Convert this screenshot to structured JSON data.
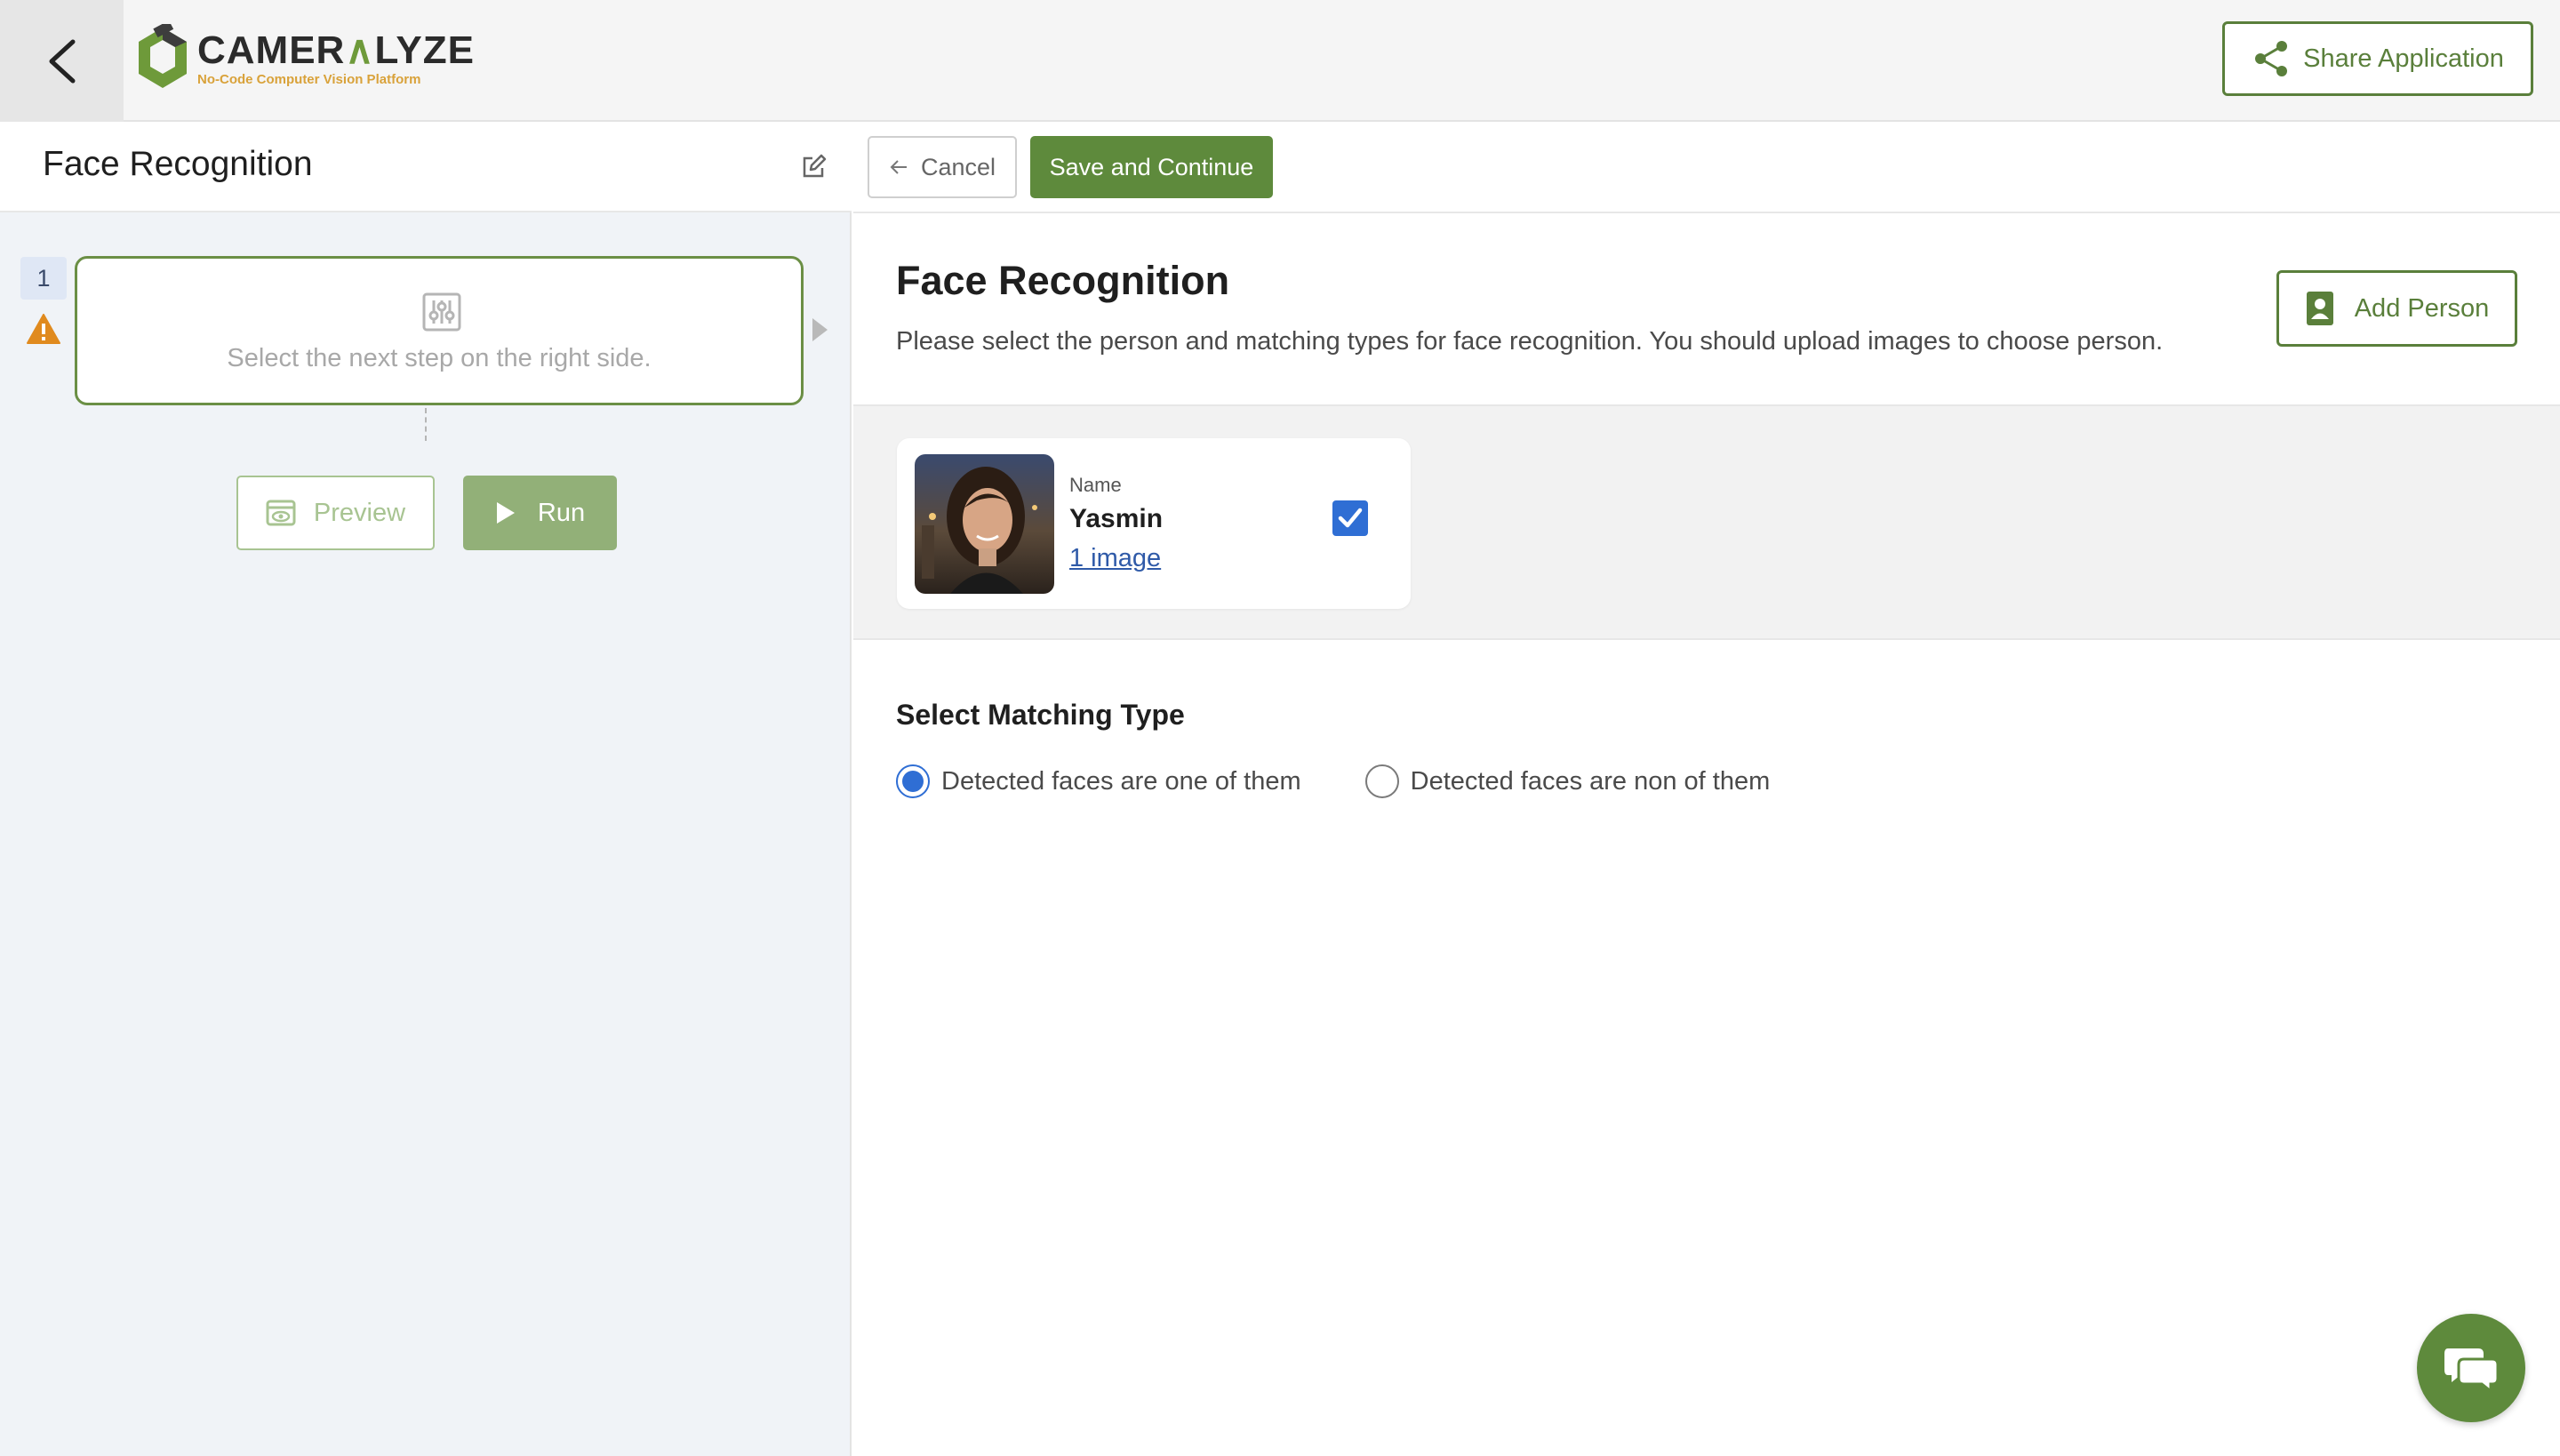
{
  "header": {
    "logo_word_left": "CAMER",
    "logo_word_right": "LYZE",
    "logo_tagline": "No-Code Computer Vision Platform",
    "share_label": "Share Application"
  },
  "left": {
    "title": "Face Recognition",
    "step_number": "1",
    "step_placeholder": "Select the next step on the right side.",
    "preview_label": "Preview",
    "run_label": "Run"
  },
  "toolbar": {
    "cancel_label": "Cancel",
    "save_label": "Save and Continue"
  },
  "main": {
    "title": "Face Recognition",
    "subtitle": "Please select the person and matching types for face recognition. You should upload images to choose person.",
    "add_person_label": "Add Person",
    "person": {
      "label": "Name",
      "name": "Yasmin",
      "images_link": "1 image",
      "selected": true
    },
    "matching_title": "Select Matching Type",
    "matching_options": [
      {
        "label": "Detected faces are one of them",
        "checked": true
      },
      {
        "label": "Detected faces are non of them",
        "checked": false
      }
    ]
  },
  "colors": {
    "brand_green": "#5e8a3c",
    "accent_blue": "#2f6ed4",
    "warning": "#e08a1e"
  }
}
